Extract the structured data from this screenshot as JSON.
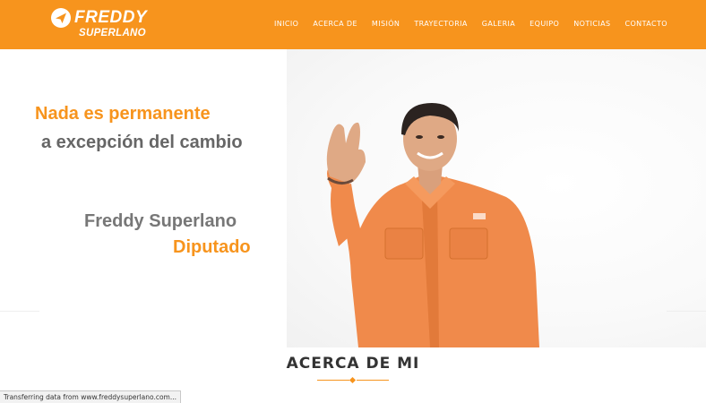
{
  "header": {
    "logo": {
      "line1": "FREDDY",
      "line2": "SUPERLANO"
    },
    "nav": [
      "INICIO",
      "ACERCA DE",
      "MISIÓN",
      "TRAYECTORIA",
      "GALERIA",
      "EQUIPO",
      "NOTICIAS",
      "CONTACTO"
    ]
  },
  "hero": {
    "tagline1": "Nada es permanente",
    "tagline2": "a excepción del cambio",
    "name": "Freddy Superlano",
    "role": "Diputado"
  },
  "section": {
    "title": "ACERCA DE MI"
  },
  "status": {
    "text": "Transferring data from www.freddysuperlano.com..."
  },
  "colors": {
    "brand_orange": "#f7941d",
    "text_gray": "#666666"
  }
}
